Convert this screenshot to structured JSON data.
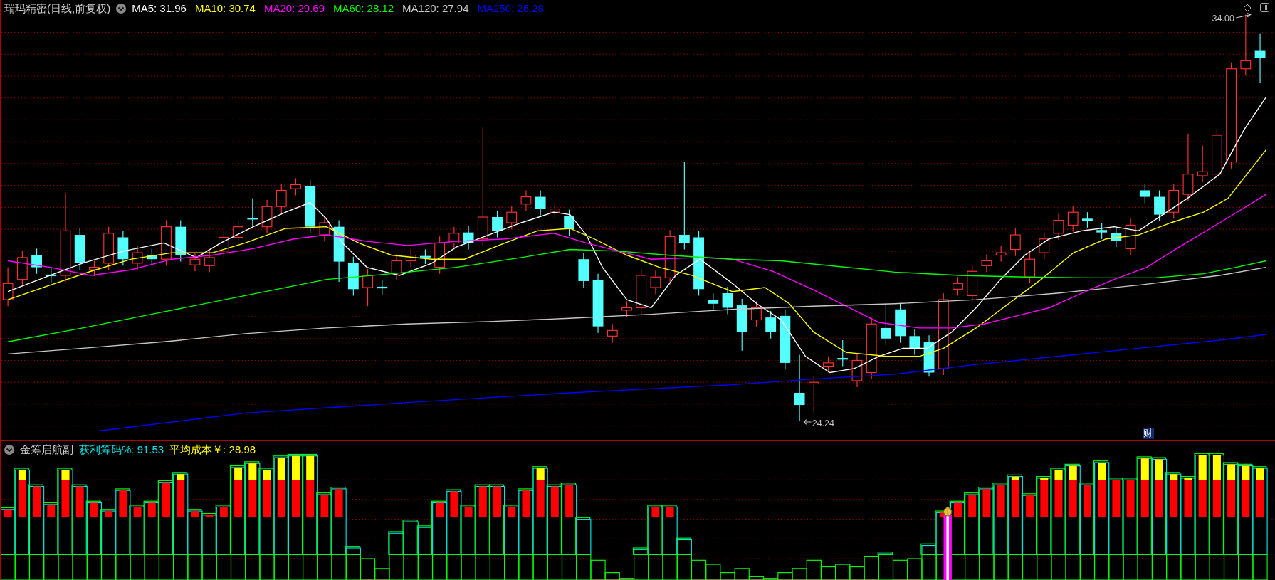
{
  "main_panel": {
    "title": "瑞玛精密(日线,前复权)",
    "moving_averages": [
      {
        "label": "MA5: 31.96",
        "color": "#ffffff"
      },
      {
        "label": "MA10: 30.74",
        "color": "#ffff00"
      },
      {
        "label": "MA20: 29.69",
        "color": "#ff00ff"
      },
      {
        "label": "MA60: 28.12",
        "color": "#00ff00"
      },
      {
        "label": "MA120: 27.94",
        "color": "#c8c8c8"
      },
      {
        "label": "MA250: 26.28",
        "color": "#0000ff"
      }
    ],
    "high_mark": "34.00",
    "low_mark": "24.24",
    "event_badge": "财"
  },
  "indicator_panel": {
    "title": "金筹启航副",
    "readings": [
      {
        "label": "获利筹码%: 91.53",
        "color": "#00e5e5"
      },
      {
        "label": "平均成本￥: 28.98",
        "color": "#ffff00"
      }
    ]
  }
}
